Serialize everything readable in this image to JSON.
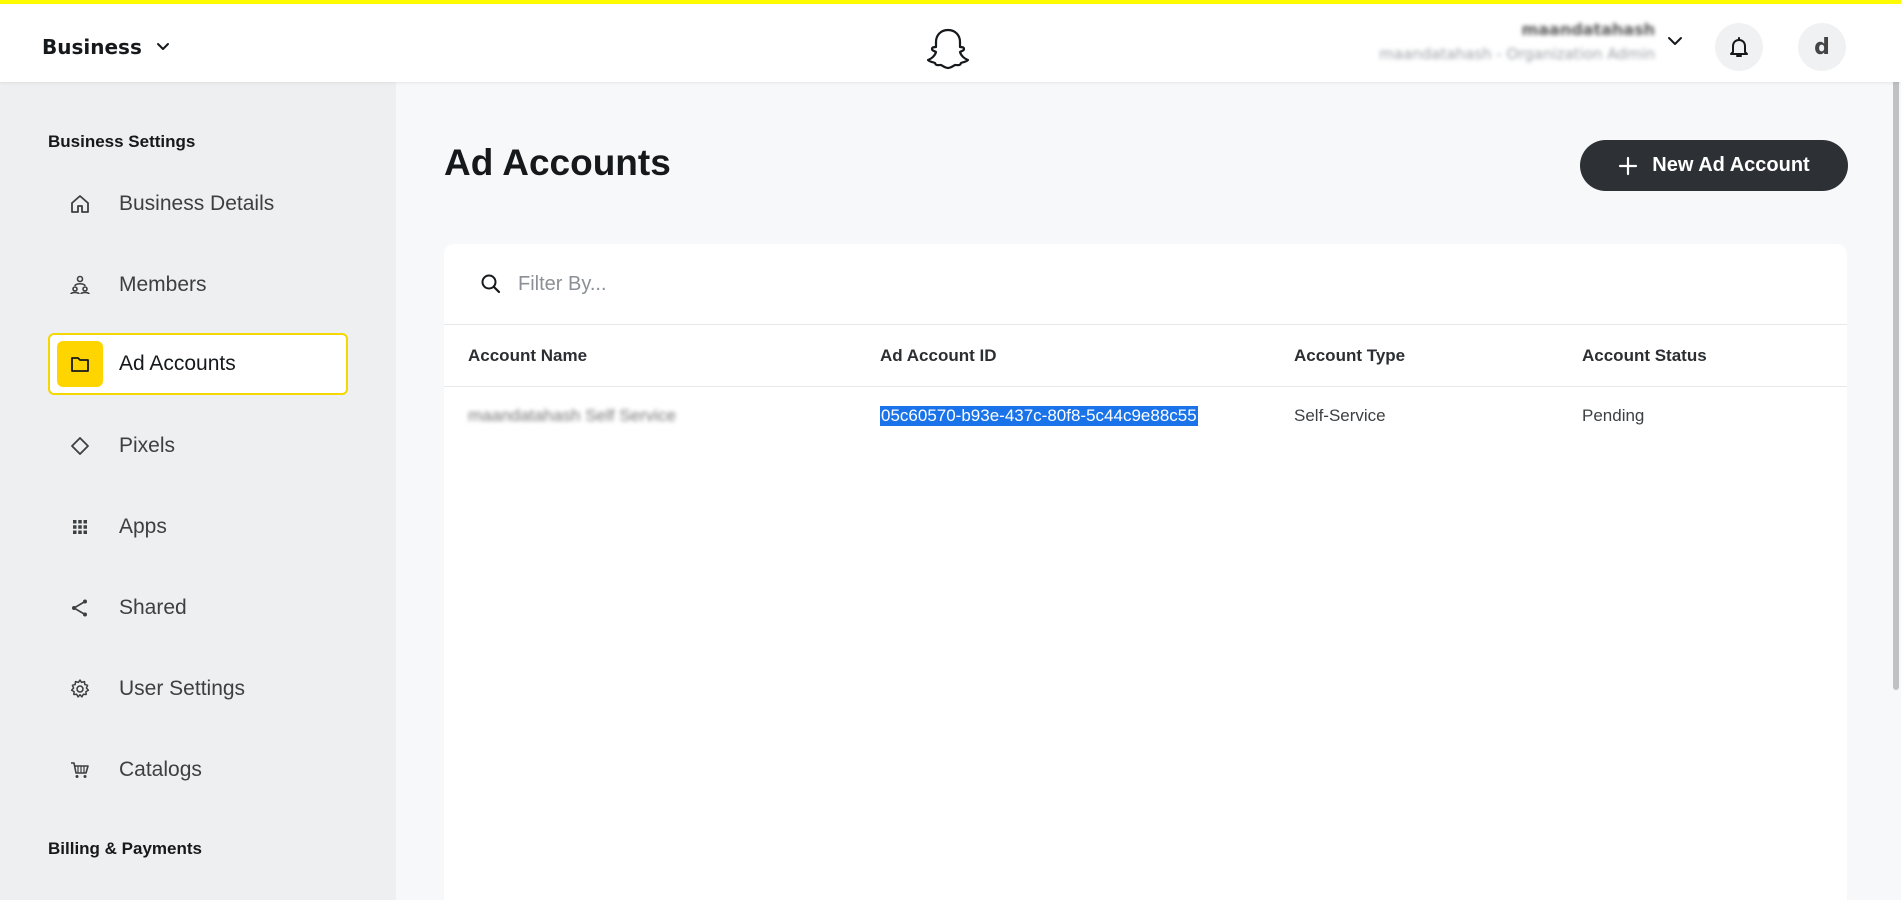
{
  "header": {
    "business_label": "Business",
    "user_name": "maandatahash",
    "user_role": "maandatahash - Organization Admin",
    "avatar_initial": "d"
  },
  "sidebar": {
    "section_title": "Business Settings",
    "items": [
      {
        "label": "Business Details",
        "icon": "home-icon"
      },
      {
        "label": "Members",
        "icon": "members-icon"
      },
      {
        "label": "Ad Accounts",
        "icon": "folder-icon",
        "active": true
      },
      {
        "label": "Pixels",
        "icon": "diamond-icon"
      },
      {
        "label": "Apps",
        "icon": "grid-icon"
      },
      {
        "label": "Shared",
        "icon": "share-icon"
      },
      {
        "label": "User Settings",
        "icon": "gear-icon"
      },
      {
        "label": "Catalogs",
        "icon": "cart-icon"
      }
    ],
    "billing_title": "Billing & Payments"
  },
  "main": {
    "page_title": "Ad Accounts",
    "new_button_label": "New Ad Account",
    "filter_placeholder": "Filter By...",
    "table": {
      "headers": [
        "Account Name",
        "Ad Account ID",
        "Account Type",
        "Account Status"
      ],
      "rows": [
        [
          "maandatahash Self Service",
          "05c60570-b93e-437c-80f8-5c44c9e88c55",
          "Self-Service",
          "Pending"
        ]
      ]
    }
  },
  "colors": {
    "accent_yellow": "#fffc00",
    "active_icon_bg": "#ffd500",
    "button_dark": "#2d3136",
    "selection_blue": "#1a73e8"
  }
}
